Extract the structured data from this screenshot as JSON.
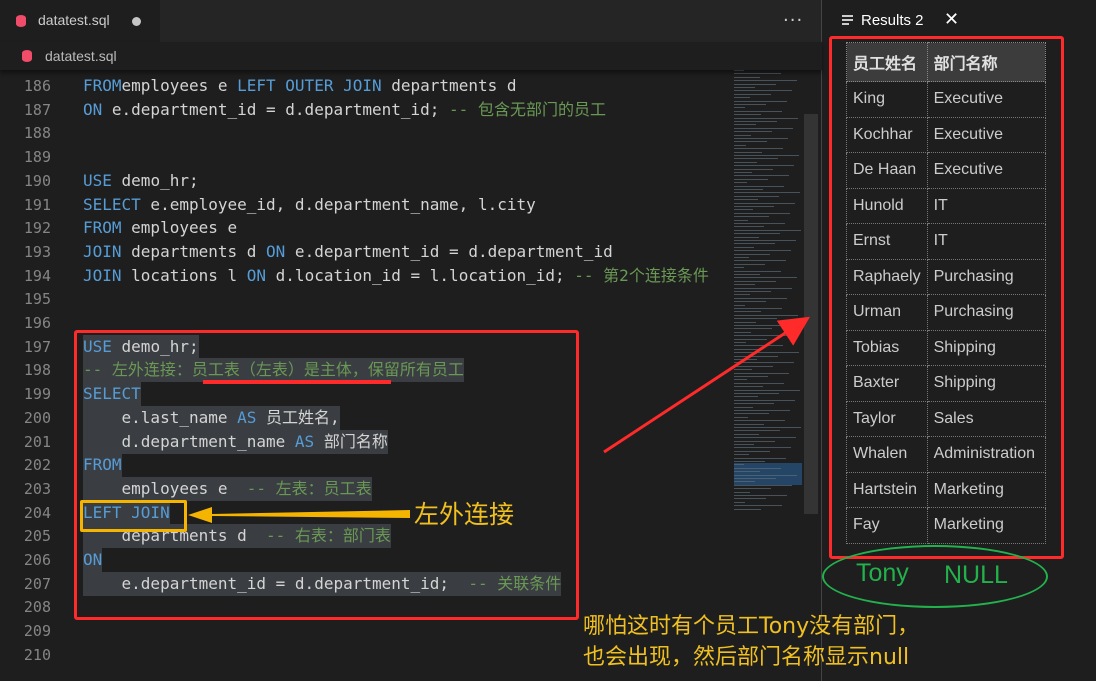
{
  "editor": {
    "tab_title": "datatest.sql",
    "breadcrumb": "datatest.sql",
    "more_label": "···",
    "lines": [
      {
        "n": "186",
        "parts": [
          [
            "kw",
            "FROM"
          ],
          [
            "",
            "employees e "
          ],
          [
            "kw",
            "LEFT OUTER JOIN"
          ],
          [
            "",
            " departments d"
          ]
        ]
      },
      {
        "n": "187",
        "parts": [
          [
            "kw",
            "ON"
          ],
          [
            "",
            " e.department_id = d.department_id; "
          ],
          [
            "cm",
            "-- 包含无部门的员工"
          ]
        ]
      },
      {
        "n": "188",
        "parts": []
      },
      {
        "n": "189",
        "parts": []
      },
      {
        "n": "190",
        "parts": [
          [
            "kw",
            "USE"
          ],
          [
            "",
            " demo_hr;"
          ]
        ]
      },
      {
        "n": "191",
        "parts": [
          [
            "kw",
            "SELECT"
          ],
          [
            "",
            " e.employee_id, d.department_name, l.city"
          ]
        ]
      },
      {
        "n": "192",
        "parts": [
          [
            "kw",
            "FROM"
          ],
          [
            "",
            " employees e"
          ]
        ]
      },
      {
        "n": "193",
        "parts": [
          [
            "kw",
            "JOIN"
          ],
          [
            "",
            " departments d "
          ],
          [
            "kw",
            "ON"
          ],
          [
            "",
            " e.department_id = d.department_id"
          ]
        ]
      },
      {
        "n": "194",
        "parts": [
          [
            "kw",
            "JOIN"
          ],
          [
            "",
            " locations l "
          ],
          [
            "kw",
            "ON"
          ],
          [
            "",
            " d.location_id = l.location_id; "
          ],
          [
            "cm",
            "-- 第2个连接条件"
          ]
        ]
      },
      {
        "n": "195",
        "parts": []
      },
      {
        "n": "196",
        "parts": []
      },
      {
        "n": "197",
        "parts": [
          [
            "kw",
            "USE"
          ],
          [
            "",
            " demo_hr;"
          ]
        ]
      },
      {
        "n": "198",
        "parts": [
          [
            "cm",
            "-- 左外连接：员工表（左表）是主体，保留所有员工"
          ]
        ]
      },
      {
        "n": "199",
        "parts": [
          [
            "kw",
            "SELECT"
          ]
        ]
      },
      {
        "n": "200",
        "parts": [
          [
            "",
            "    e.last_name "
          ],
          [
            "kw",
            "AS"
          ],
          [
            "",
            " 员工姓名,"
          ]
        ]
      },
      {
        "n": "201",
        "parts": [
          [
            "",
            "    d.department_name "
          ],
          [
            "kw",
            "AS"
          ],
          [
            "",
            " 部门名称"
          ]
        ]
      },
      {
        "n": "202",
        "parts": [
          [
            "kw",
            "FROM"
          ]
        ]
      },
      {
        "n": "203",
        "parts": [
          [
            "",
            "    employees e  "
          ],
          [
            "cm",
            "-- 左表：员工表"
          ]
        ]
      },
      {
        "n": "204",
        "parts": [
          [
            "kw",
            "LEFT JOIN"
          ]
        ]
      },
      {
        "n": "205",
        "parts": [
          [
            "",
            "    departments d  "
          ],
          [
            "cm",
            "-- 右表：部门表"
          ]
        ]
      },
      {
        "n": "206",
        "parts": [
          [
            "kw",
            "ON"
          ]
        ]
      },
      {
        "n": "207",
        "parts": [
          [
            "",
            "    e.department_id = d.department_id;  "
          ],
          [
            "cm",
            "-- 关联条件"
          ]
        ]
      },
      {
        "n": "208",
        "parts": []
      },
      {
        "n": "209",
        "parts": []
      },
      {
        "n": "210",
        "parts": []
      }
    ]
  },
  "results": {
    "tab_title": "Results 2",
    "close_label": "✕",
    "headers": [
      "员工姓名",
      "部门名称"
    ],
    "rows": [
      [
        "King",
        "Executive"
      ],
      [
        "Kochhar",
        "Executive"
      ],
      [
        "De Haan",
        "Executive"
      ],
      [
        "Hunold",
        "IT"
      ],
      [
        "Ernst",
        "IT"
      ],
      [
        "Raphaely",
        "Purchasing"
      ],
      [
        "Urman",
        "Purchasing"
      ],
      [
        "Tobias",
        "Shipping"
      ],
      [
        "Baxter",
        "Shipping"
      ],
      [
        "Taylor",
        "Sales"
      ],
      [
        "Whalen",
        "Administration"
      ],
      [
        "Hartstein",
        "Marketing"
      ],
      [
        "Fay",
        "Marketing"
      ]
    ]
  },
  "annotations": {
    "left_join_label": "左外连接",
    "note_line1": "哪怕这时有个员工Tony没有部门，",
    "note_line2": "也会出现，然后部门名称显示null",
    "ellipse_name": "Tony",
    "ellipse_value": "NULL"
  },
  "colors": {
    "keyword": "#569cd6",
    "comment": "#6a9955",
    "annotation_red": "#ff2a2a",
    "annotation_yellow": "#f5b400",
    "annotation_green": "#22b14c"
  }
}
